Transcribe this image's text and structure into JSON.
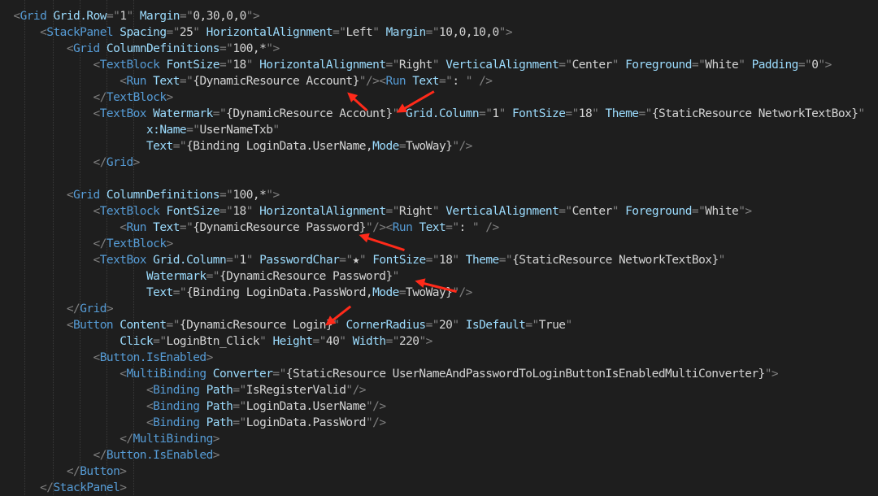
{
  "editor": {
    "lines": [
      {
        "indent": "  ",
        "tokens": [
          [
            "p",
            "<"
          ],
          [
            "t",
            "Grid"
          ],
          [
            "s",
            " "
          ],
          [
            "a",
            "Grid.Row"
          ],
          [
            "p",
            "=\""
          ],
          [
            "v",
            "1"
          ],
          [
            "p",
            "\""
          ],
          [
            "s",
            " "
          ],
          [
            "a",
            "Margin"
          ],
          [
            "p",
            "=\""
          ],
          [
            "v",
            "0,30,0,0"
          ],
          [
            "p",
            "\">"
          ]
        ]
      },
      {
        "indent": "      ",
        "tokens": [
          [
            "p",
            "<"
          ],
          [
            "t",
            "StackPanel"
          ],
          [
            "s",
            " "
          ],
          [
            "a",
            "Spacing"
          ],
          [
            "p",
            "=\""
          ],
          [
            "v",
            "25"
          ],
          [
            "p",
            "\""
          ],
          [
            "s",
            " "
          ],
          [
            "a",
            "HorizontalAlignment"
          ],
          [
            "p",
            "=\""
          ],
          [
            "v",
            "Left"
          ],
          [
            "p",
            "\""
          ],
          [
            "s",
            " "
          ],
          [
            "a",
            "Margin"
          ],
          [
            "p",
            "=\""
          ],
          [
            "v",
            "10,0,10,0"
          ],
          [
            "p",
            "\">"
          ]
        ]
      },
      {
        "indent": "          ",
        "tokens": [
          [
            "p",
            "<"
          ],
          [
            "t",
            "Grid"
          ],
          [
            "s",
            " "
          ],
          [
            "a",
            "ColumnDefinitions"
          ],
          [
            "p",
            "=\""
          ],
          [
            "v",
            "100,*"
          ],
          [
            "p",
            "\">"
          ]
        ]
      },
      {
        "indent": "              ",
        "tokens": [
          [
            "p",
            "<"
          ],
          [
            "t",
            "TextBlock"
          ],
          [
            "s",
            " "
          ],
          [
            "a",
            "FontSize"
          ],
          [
            "p",
            "=\""
          ],
          [
            "v",
            "18"
          ],
          [
            "p",
            "\""
          ],
          [
            "s",
            " "
          ],
          [
            "a",
            "HorizontalAlignment"
          ],
          [
            "p",
            "=\""
          ],
          [
            "v",
            "Right"
          ],
          [
            "p",
            "\""
          ],
          [
            "s",
            " "
          ],
          [
            "a",
            "VerticalAlignment"
          ],
          [
            "p",
            "=\""
          ],
          [
            "v",
            "Center"
          ],
          [
            "p",
            "\""
          ],
          [
            "s",
            " "
          ],
          [
            "a",
            "Foreground"
          ],
          [
            "p",
            "=\""
          ],
          [
            "v",
            "White"
          ],
          [
            "p",
            "\""
          ],
          [
            "s",
            " "
          ],
          [
            "a",
            "Padding"
          ],
          [
            "p",
            "=\""
          ],
          [
            "v",
            "0"
          ],
          [
            "p",
            "\">"
          ]
        ]
      },
      {
        "indent": "                  ",
        "tokens": [
          [
            "p",
            "<"
          ],
          [
            "t",
            "Run"
          ],
          [
            "s",
            " "
          ],
          [
            "a",
            "Text"
          ],
          [
            "p",
            "=\""
          ],
          [
            "v",
            "{DynamicResource Account}"
          ],
          [
            "p",
            "\"/><"
          ],
          [
            "t",
            "Run"
          ],
          [
            "s",
            " "
          ],
          [
            "a",
            "Text"
          ],
          [
            "p",
            "=\""
          ],
          [
            "v",
            ": "
          ],
          [
            "p",
            "\""
          ],
          [
            "s",
            " "
          ],
          [
            "p",
            "/>"
          ]
        ]
      },
      {
        "indent": "              ",
        "tokens": [
          [
            "p",
            "</"
          ],
          [
            "t",
            "TextBlock"
          ],
          [
            "p",
            ">"
          ]
        ]
      },
      {
        "indent": "              ",
        "tokens": [
          [
            "p",
            "<"
          ],
          [
            "t",
            "TextBox"
          ],
          [
            "s",
            " "
          ],
          [
            "a",
            "Watermark"
          ],
          [
            "p",
            "=\""
          ],
          [
            "v",
            "{DynamicResource Account}"
          ],
          [
            "p",
            "\""
          ],
          [
            "s",
            " "
          ],
          [
            "a",
            "Grid.Column"
          ],
          [
            "p",
            "=\""
          ],
          [
            "v",
            "1"
          ],
          [
            "p",
            "\""
          ],
          [
            "s",
            " "
          ],
          [
            "a",
            "FontSize"
          ],
          [
            "p",
            "=\""
          ],
          [
            "v",
            "18"
          ],
          [
            "p",
            "\""
          ],
          [
            "s",
            " "
          ],
          [
            "a",
            "Theme"
          ],
          [
            "p",
            "=\""
          ],
          [
            "v",
            "{StaticResource NetworkTextBox}"
          ],
          [
            "p",
            "\""
          ]
        ]
      },
      {
        "indent": "                      ",
        "tokens": [
          [
            "a",
            "x:Name"
          ],
          [
            "p",
            "=\""
          ],
          [
            "v",
            "UserNameTxb"
          ],
          [
            "p",
            "\""
          ]
        ]
      },
      {
        "indent": "                      ",
        "tokens": [
          [
            "a",
            "Text"
          ],
          [
            "p",
            "=\""
          ],
          [
            "v",
            "{Binding LoginData.UserName,"
          ],
          [
            "a",
            "Mode"
          ],
          [
            "p",
            "="
          ],
          [
            "v",
            "TwoWay}"
          ],
          [
            "p",
            "\"/>"
          ]
        ]
      },
      {
        "indent": "              ",
        "tokens": [
          [
            "p",
            "</"
          ],
          [
            "t",
            "Grid"
          ],
          [
            "p",
            ">"
          ]
        ]
      },
      {
        "indent": "",
        "tokens": []
      },
      {
        "indent": "          ",
        "tokens": [
          [
            "p",
            "<"
          ],
          [
            "t",
            "Grid"
          ],
          [
            "s",
            " "
          ],
          [
            "a",
            "ColumnDefinitions"
          ],
          [
            "p",
            "=\""
          ],
          [
            "v",
            "100,*"
          ],
          [
            "p",
            "\">"
          ]
        ]
      },
      {
        "indent": "              ",
        "tokens": [
          [
            "p",
            "<"
          ],
          [
            "t",
            "TextBlock"
          ],
          [
            "s",
            " "
          ],
          [
            "a",
            "FontSize"
          ],
          [
            "p",
            "=\""
          ],
          [
            "v",
            "18"
          ],
          [
            "p",
            "\""
          ],
          [
            "s",
            " "
          ],
          [
            "a",
            "HorizontalAlignment"
          ],
          [
            "p",
            "=\""
          ],
          [
            "v",
            "Right"
          ],
          [
            "p",
            "\""
          ],
          [
            "s",
            " "
          ],
          [
            "a",
            "VerticalAlignment"
          ],
          [
            "p",
            "=\""
          ],
          [
            "v",
            "Center"
          ],
          [
            "p",
            "\""
          ],
          [
            "s",
            " "
          ],
          [
            "a",
            "Foreground"
          ],
          [
            "p",
            "=\""
          ],
          [
            "v",
            "White"
          ],
          [
            "p",
            "\">"
          ]
        ]
      },
      {
        "indent": "                  ",
        "tokens": [
          [
            "p",
            "<"
          ],
          [
            "t",
            "Run"
          ],
          [
            "s",
            " "
          ],
          [
            "a",
            "Text"
          ],
          [
            "p",
            "=\""
          ],
          [
            "v",
            "{DynamicResource Password}"
          ],
          [
            "p",
            "\"/><"
          ],
          [
            "t",
            "Run"
          ],
          [
            "s",
            " "
          ],
          [
            "a",
            "Text"
          ],
          [
            "p",
            "=\""
          ],
          [
            "v",
            ": "
          ],
          [
            "p",
            "\""
          ],
          [
            "s",
            " "
          ],
          [
            "p",
            "/>"
          ]
        ]
      },
      {
        "indent": "              ",
        "tokens": [
          [
            "p",
            "</"
          ],
          [
            "t",
            "TextBlock"
          ],
          [
            "p",
            ">"
          ]
        ]
      },
      {
        "indent": "              ",
        "tokens": [
          [
            "p",
            "<"
          ],
          [
            "t",
            "TextBox"
          ],
          [
            "s",
            " "
          ],
          [
            "a",
            "Grid.Column"
          ],
          [
            "p",
            "=\""
          ],
          [
            "v",
            "1"
          ],
          [
            "p",
            "\""
          ],
          [
            "s",
            " "
          ],
          [
            "a",
            "PasswordChar"
          ],
          [
            "p",
            "=\""
          ],
          [
            "v",
            "★"
          ],
          [
            "p",
            "\""
          ],
          [
            "s",
            " "
          ],
          [
            "a",
            "FontSize"
          ],
          [
            "p",
            "=\""
          ],
          [
            "v",
            "18"
          ],
          [
            "p",
            "\""
          ],
          [
            "s",
            " "
          ],
          [
            "a",
            "Theme"
          ],
          [
            "p",
            "=\""
          ],
          [
            "v",
            "{StaticResource NetworkTextBox}"
          ],
          [
            "p",
            "\""
          ]
        ]
      },
      {
        "indent": "                      ",
        "tokens": [
          [
            "a",
            "Watermark"
          ],
          [
            "p",
            "=\""
          ],
          [
            "v",
            "{DynamicResource Password}"
          ],
          [
            "p",
            "\""
          ]
        ]
      },
      {
        "indent": "                      ",
        "tokens": [
          [
            "a",
            "Text"
          ],
          [
            "p",
            "=\""
          ],
          [
            "v",
            "{Binding LoginData.PassWord,"
          ],
          [
            "a",
            "Mode"
          ],
          [
            "p",
            "="
          ],
          [
            "v",
            "TwoWay}"
          ],
          [
            "p",
            "\"/>"
          ]
        ]
      },
      {
        "indent": "          ",
        "tokens": [
          [
            "p",
            "</"
          ],
          [
            "t",
            "Grid"
          ],
          [
            "p",
            ">"
          ]
        ]
      },
      {
        "indent": "          ",
        "tokens": [
          [
            "p",
            "<"
          ],
          [
            "t",
            "Button"
          ],
          [
            "s",
            " "
          ],
          [
            "a",
            "Content"
          ],
          [
            "p",
            "=\""
          ],
          [
            "v",
            "{DynamicResource Login}"
          ],
          [
            "p",
            "\""
          ],
          [
            "s",
            " "
          ],
          [
            "a",
            "CornerRadius"
          ],
          [
            "p",
            "=\""
          ],
          [
            "v",
            "20"
          ],
          [
            "p",
            "\""
          ],
          [
            "s",
            " "
          ],
          [
            "a",
            "IsDefault"
          ],
          [
            "p",
            "=\""
          ],
          [
            "v",
            "True"
          ],
          [
            "p",
            "\""
          ]
        ]
      },
      {
        "indent": "                  ",
        "tokens": [
          [
            "a",
            "Click"
          ],
          [
            "p",
            "=\""
          ],
          [
            "v",
            "LoginBtn_Click"
          ],
          [
            "p",
            "\""
          ],
          [
            "s",
            " "
          ],
          [
            "a",
            "Height"
          ],
          [
            "p",
            "=\""
          ],
          [
            "v",
            "40"
          ],
          [
            "p",
            "\""
          ],
          [
            "s",
            " "
          ],
          [
            "a",
            "Width"
          ],
          [
            "p",
            "=\""
          ],
          [
            "v",
            "220"
          ],
          [
            "p",
            "\">"
          ]
        ]
      },
      {
        "indent": "              ",
        "tokens": [
          [
            "p",
            "<"
          ],
          [
            "t",
            "Button.IsEnabled"
          ],
          [
            "p",
            ">"
          ]
        ]
      },
      {
        "indent": "                  ",
        "tokens": [
          [
            "p",
            "<"
          ],
          [
            "t",
            "MultiBinding"
          ],
          [
            "s",
            " "
          ],
          [
            "a",
            "Converter"
          ],
          [
            "p",
            "=\""
          ],
          [
            "v",
            "{StaticResource UserNameAndPasswordToLoginButtonIsEnabledMultiConverter}"
          ],
          [
            "p",
            "\">"
          ]
        ]
      },
      {
        "indent": "                      ",
        "tokens": [
          [
            "p",
            "<"
          ],
          [
            "t",
            "Binding"
          ],
          [
            "s",
            " "
          ],
          [
            "a",
            "Path"
          ],
          [
            "p",
            "=\""
          ],
          [
            "v",
            "IsRegisterValid"
          ],
          [
            "p",
            "\"/>"
          ]
        ]
      },
      {
        "indent": "                      ",
        "tokens": [
          [
            "p",
            "<"
          ],
          [
            "t",
            "Binding"
          ],
          [
            "s",
            " "
          ],
          [
            "a",
            "Path"
          ],
          [
            "p",
            "=\""
          ],
          [
            "v",
            "LoginData.UserName"
          ],
          [
            "p",
            "\"/>"
          ]
        ]
      },
      {
        "indent": "                      ",
        "tokens": [
          [
            "p",
            "<"
          ],
          [
            "t",
            "Binding"
          ],
          [
            "s",
            " "
          ],
          [
            "a",
            "Path"
          ],
          [
            "p",
            "=\""
          ],
          [
            "v",
            "LoginData.PassWord"
          ],
          [
            "p",
            "\"/>"
          ]
        ]
      },
      {
        "indent": "                  ",
        "tokens": [
          [
            "p",
            "</"
          ],
          [
            "t",
            "MultiBinding"
          ],
          [
            "p",
            ">"
          ]
        ]
      },
      {
        "indent": "              ",
        "tokens": [
          [
            "p",
            "</"
          ],
          [
            "t",
            "Button.IsEnabled"
          ],
          [
            "p",
            ">"
          ]
        ]
      },
      {
        "indent": "          ",
        "tokens": [
          [
            "p",
            "</"
          ],
          [
            "t",
            "Button"
          ],
          [
            "p",
            ">"
          ]
        ]
      },
      {
        "indent": "      ",
        "tokens": [
          [
            "p",
            "</"
          ],
          [
            "t",
            "StackPanel"
          ],
          [
            "p",
            ">"
          ]
        ]
      }
    ]
  },
  "colors": {
    "background": "#1e1e1e",
    "punctuation": "#808080",
    "tag": "#569cd6",
    "attribute": "#9cdcfe",
    "value": "#d4d4d4",
    "annotation_arrow": "#ff2a1a"
  }
}
